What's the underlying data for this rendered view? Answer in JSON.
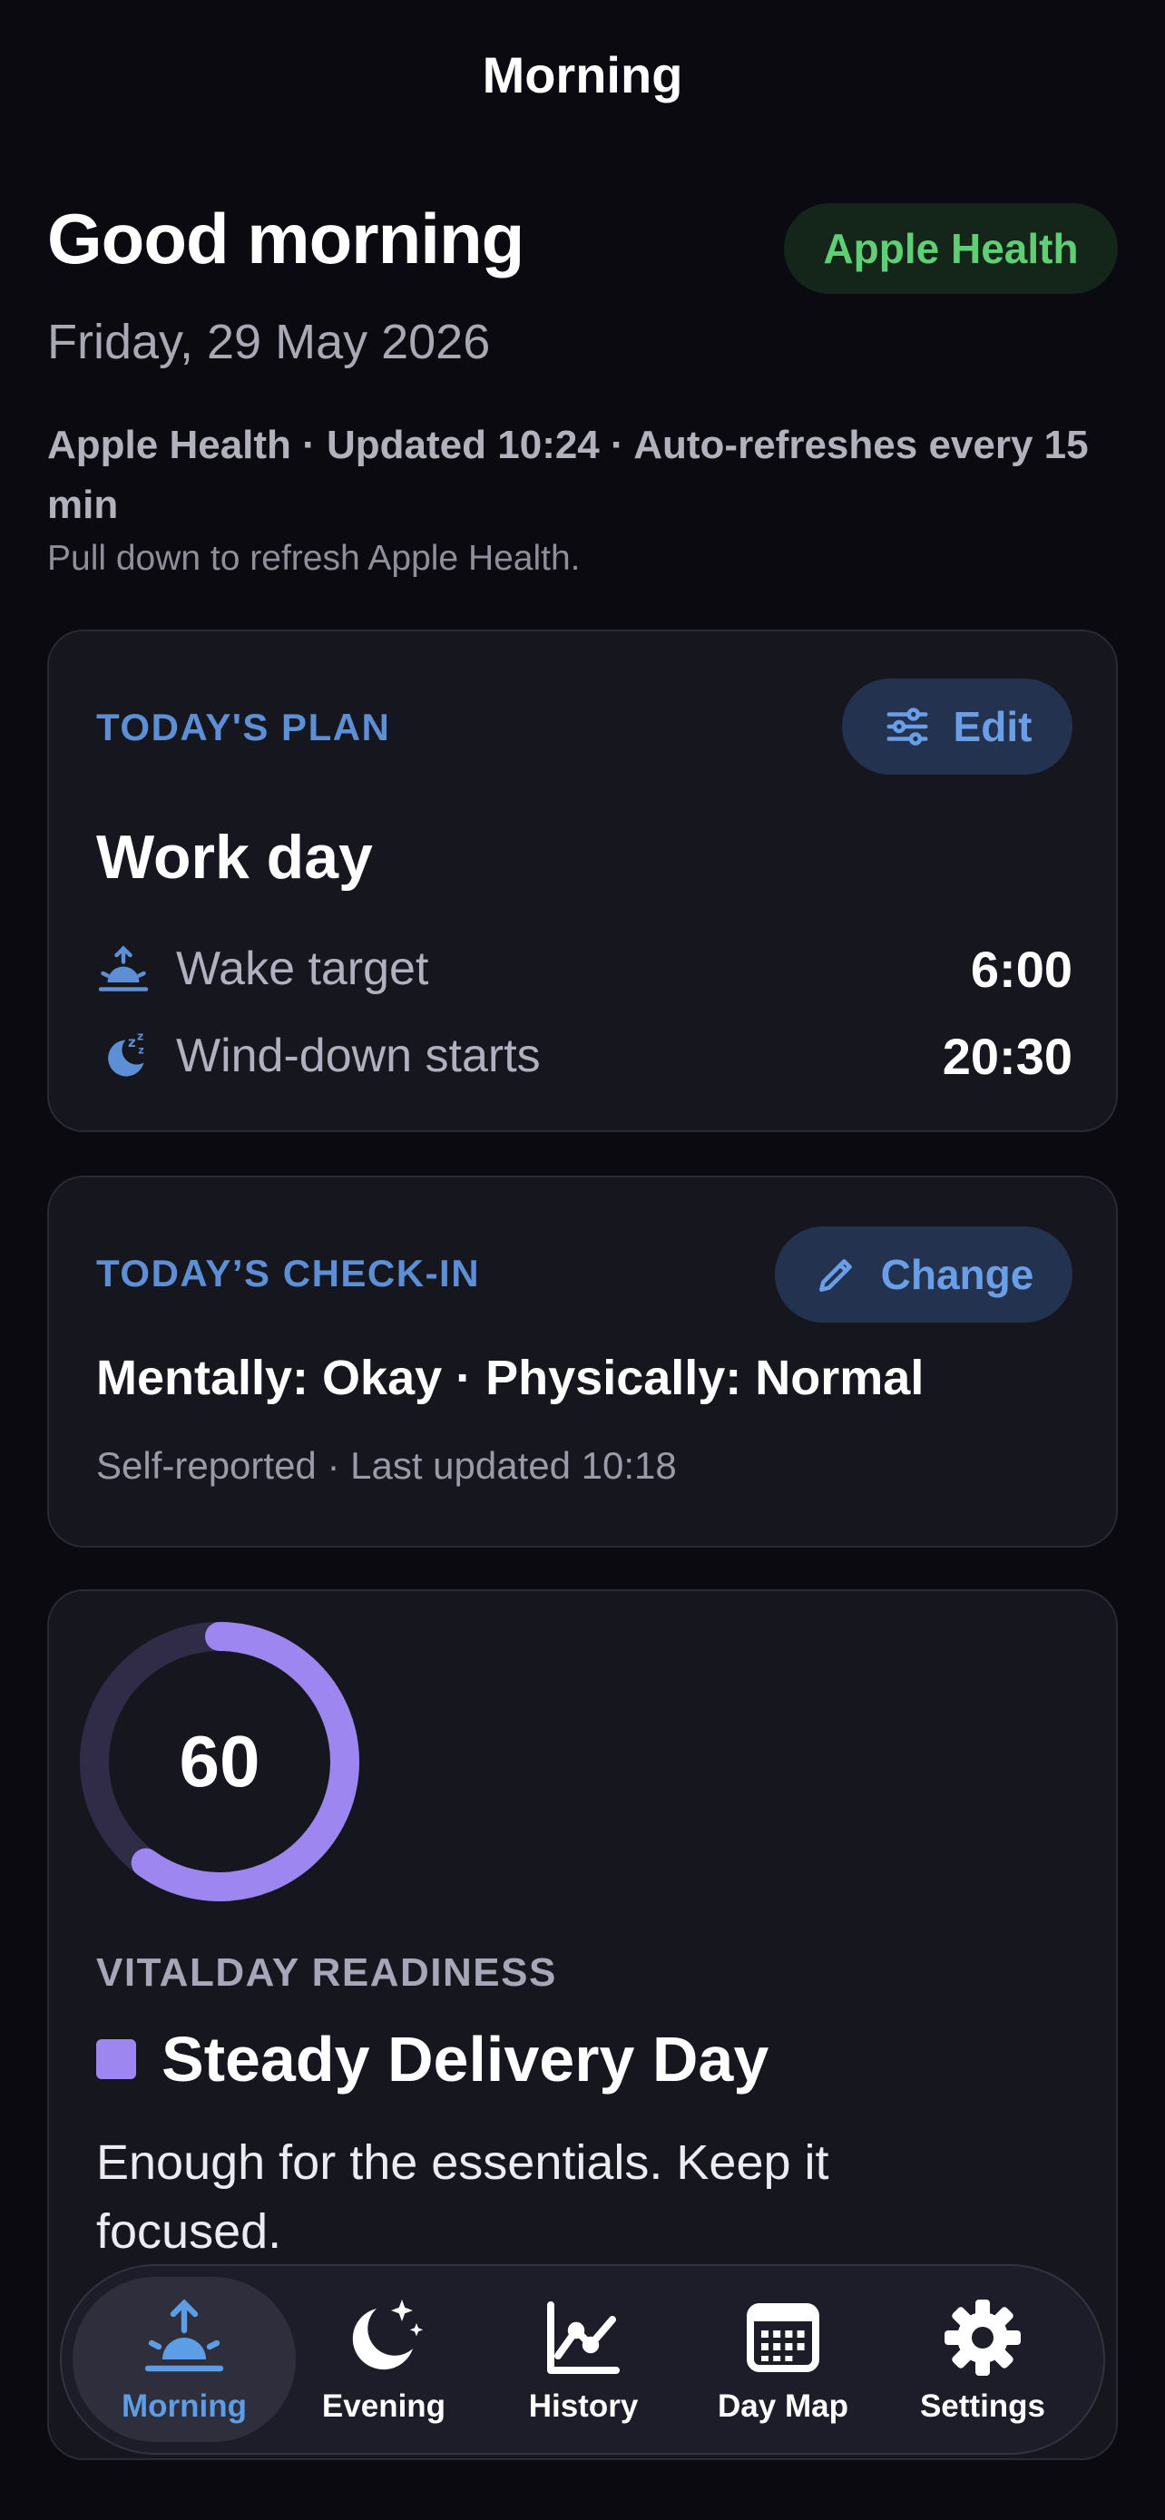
{
  "header": {
    "title": "Morning"
  },
  "greeting": "Good morning",
  "health_badge": "Apple Health",
  "date": "Friday, 29 May 2026",
  "sync": {
    "status": "Apple Health · Updated 10:24 · Auto-refreshes every 15 min",
    "hint": "Pull down to refresh Apple Health."
  },
  "plan": {
    "label": "TODAY'S PLAN",
    "edit_label": "Edit",
    "title": "Work day",
    "rows": [
      {
        "label": "Wake target",
        "value": "6:00",
        "icon": "sunrise-icon"
      },
      {
        "label": "Wind-down starts",
        "value": "20:30",
        "icon": "moon-sleep-icon"
      }
    ]
  },
  "checkin": {
    "label": "TODAY’S CHECK-IN",
    "change_label": "Change",
    "summary": "Mentally: Okay · Physically: Normal",
    "meta": "Self-reported · Last updated 10:18"
  },
  "readiness": {
    "score": "60",
    "progress_percent": 60,
    "label": "VITALDAY READINESS",
    "title": "Steady Delivery Day",
    "description": "Enough for the essentials. Keep it focused.",
    "accent_color": "#9d86f0"
  },
  "tabs": [
    {
      "label": "Morning",
      "icon": "sunrise-icon",
      "active": true
    },
    {
      "label": "Evening",
      "icon": "moon-stars-icon",
      "active": false
    },
    {
      "label": "History",
      "icon": "chart-icon",
      "active": false
    },
    {
      "label": "Day Map",
      "icon": "calendar-grid-icon",
      "active": false
    },
    {
      "label": "Settings",
      "icon": "gear-icon",
      "active": false
    }
  ],
  "colors": {
    "background": "#0a0a10",
    "card": "#16161f",
    "accent_blue": "#5c8fd6",
    "health_green": "#5fce74"
  }
}
